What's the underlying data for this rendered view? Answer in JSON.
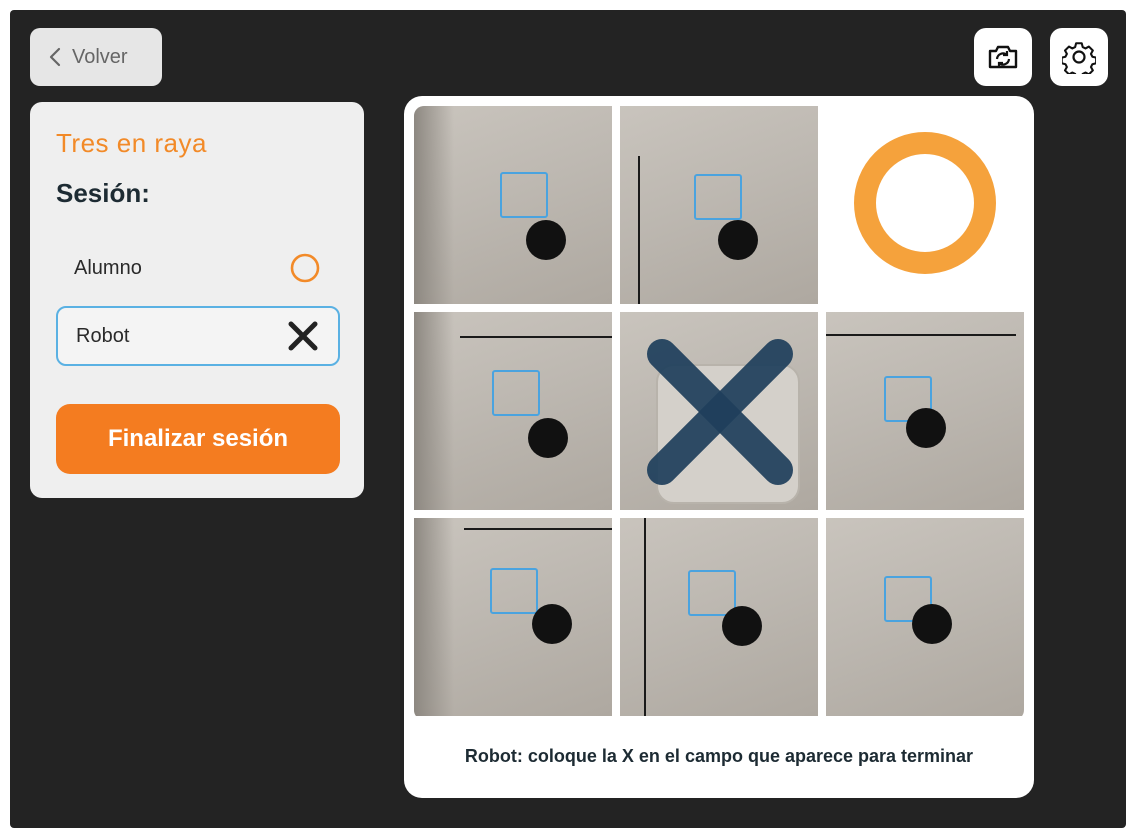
{
  "nav": {
    "back_label": "Volver"
  },
  "toolbar": {
    "camera_icon": "camera-switch-icon",
    "settings_icon": "gear-icon"
  },
  "panel": {
    "game_title": "Tres en raya",
    "session_label": "Sesión:",
    "players": [
      {
        "name": "Alumno",
        "symbol": "O",
        "symbol_color": "#f28a28"
      },
      {
        "name": "Robot",
        "symbol": "X",
        "symbol_color": "#222222",
        "active": true
      }
    ],
    "finish_label": "Finalizar sesión"
  },
  "board": {
    "cells": [
      "",
      "",
      "O",
      "",
      "X",
      "",
      "",
      "",
      ""
    ],
    "o_color": "#f5a23c",
    "x_color": "#1f3f5c",
    "target_color": "#4aa3df"
  },
  "status": {
    "message": "Robot: coloque la X en el campo que aparece para terminar"
  },
  "colors": {
    "accent": "#f47c20",
    "background": "#232323",
    "active_border": "#5ab1e3"
  }
}
